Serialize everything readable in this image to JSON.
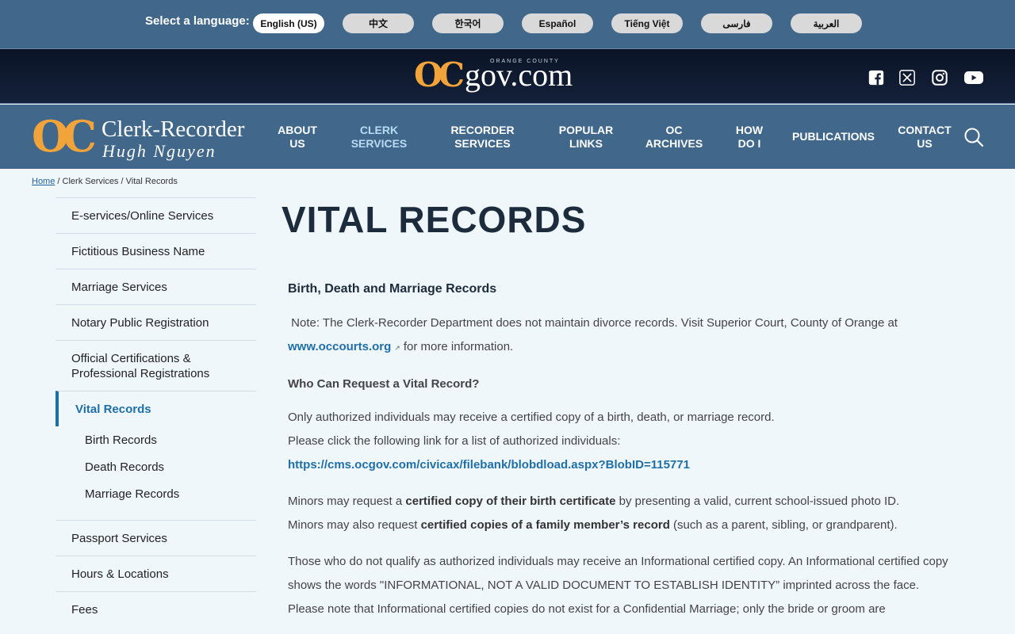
{
  "langbar": {
    "label": "Select a language:",
    "languages": [
      "English (US)",
      "中文",
      "한국어",
      "Español",
      "Tiếng Việt",
      "فارسی",
      "العربية"
    ]
  },
  "header": {
    "brand_mark": "OC",
    "brand_domain": "gov.com",
    "brand_county": "ORANGE COUNTY"
  },
  "nav": {
    "logo_mark": "OC",
    "logo_line1": "Clerk-Recorder",
    "logo_line2": "Hugh Nguyen",
    "items": [
      {
        "line1": "About",
        "line2": "Us"
      },
      {
        "line1": "Clerk",
        "line2": "Services"
      },
      {
        "line1": "Recorder",
        "line2": "Services"
      },
      {
        "line1": "Popular",
        "line2": "Links"
      },
      {
        "line1": "OC",
        "line2": "Archives"
      },
      {
        "line1": "How",
        "line2": "Do I"
      },
      {
        "line1": "Publications",
        "line2": ""
      },
      {
        "line1": "Contact",
        "line2": "Us"
      }
    ]
  },
  "breadcrumb": {
    "home": "Home",
    "sep": "/",
    "level1": "Clerk Services",
    "level2": "Vital Records"
  },
  "sidebar": {
    "items": [
      "E-services/Online Services",
      "Fictitious Business Name",
      "Marriage Services",
      "Notary Public Registration",
      "Official Certifications &",
      "Professional Registrations",
      "Vital Records",
      "Birth Records",
      "Death Records",
      "Marriage Records",
      "Passport Services",
      "Hours & Locations",
      "Fees"
    ]
  },
  "main": {
    "title": "VITAL RECORDS",
    "heading": "Birth, Death and Marriage Records",
    "note_text": "Note: The Clerk-Recorder Department does not maintain divorce records. Visit Superior Court, County of Orange at",
    "note_link": "www.occourts.org",
    "note_ext": "↗",
    "note_tail": "for more information.",
    "who_heading": "Who Can Request a Vital Record?",
    "para1_line1": "Only authorized individuals may receive a certified copy of a birth, death, or marriage record.",
    "para1_line2": "Please click the following link for a list of authorized individuals:",
    "para1_link": "https://cms.ocgov.com/civicax/filebank/blobdload.aspx?BlobID=115771",
    "para2_a": "Minors may request a",
    "para2_b": "certified copy of their birth certificate",
    "para2_c": "by presenting a valid, current school-issued photo ID.",
    "para2_d": "Minors may also request",
    "para2_e": "certified copies of a family member’s record",
    "para2_f": "(such as a parent, sibling, or grandparent).",
    "para3": "Those who do not qualify as authorized individuals may receive an Informational certified copy. An Informational certified copy shows the words \"INFORMATIONAL, NOT A VALID DOCUMENT TO ESTABLISH IDENTITY” imprinted across the face. Please note that Informational certified copies do not exist for a Confidential Marriage; only the bride or groom are"
  }
}
